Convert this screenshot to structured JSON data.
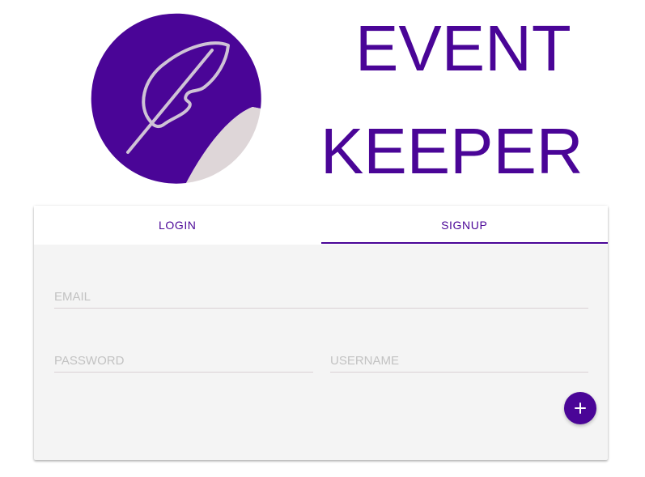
{
  "header": {
    "logo_icon": "feather-sticker-icon",
    "title_line_1": "EVENT",
    "title_line_2": "KEEPER"
  },
  "tabs": {
    "items": [
      {
        "label": "LOGIN",
        "selected": false
      },
      {
        "label": "SIGNUP",
        "selected": true
      }
    ]
  },
  "form": {
    "email_placeholder": "EMAIL",
    "email_value": "",
    "password_placeholder": "PASSWORD",
    "password_value": "",
    "username_placeholder": "USERNAME",
    "username_value": ""
  },
  "fab": {
    "icon": "plus-icon"
  },
  "colors": {
    "brand": "#4a0597",
    "card_background": "#f4f4f4",
    "tab_bar_background": "#ffffff",
    "field_line": "#d9d1d4",
    "sticker_curl": "#ded6d8",
    "feather_stroke": "#cfc3d6",
    "placeholder": "#c2c2c2"
  }
}
